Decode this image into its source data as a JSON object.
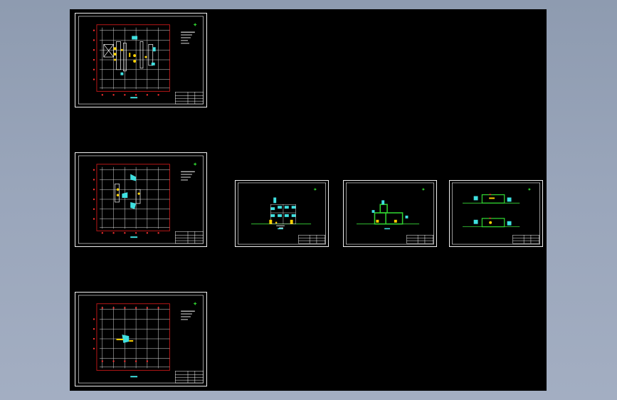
{
  "window": {
    "title": ""
  },
  "colors": {
    "background": "#000000",
    "frame": "#ffffff",
    "grid": "#ffffff",
    "boundary": "#cc1a1a",
    "axis_marker": "#ff3030",
    "highlight": "#ffd200",
    "accent_cyan": "#3fe0e0",
    "accent_green": "#2fd02f",
    "ground_line": "#38d838"
  },
  "sheets": [
    {
      "id": "plan-1",
      "kind": "floor-plan"
    },
    {
      "id": "plan-2",
      "kind": "floor-plan"
    },
    {
      "id": "plan-3",
      "kind": "floor-plan"
    },
    {
      "id": "elevation-1",
      "kind": "elevation"
    },
    {
      "id": "elevation-2",
      "kind": "elevation"
    },
    {
      "id": "section-1",
      "kind": "section"
    }
  ],
  "icons": {
    "north_arrow": "north-arrow-icon"
  }
}
